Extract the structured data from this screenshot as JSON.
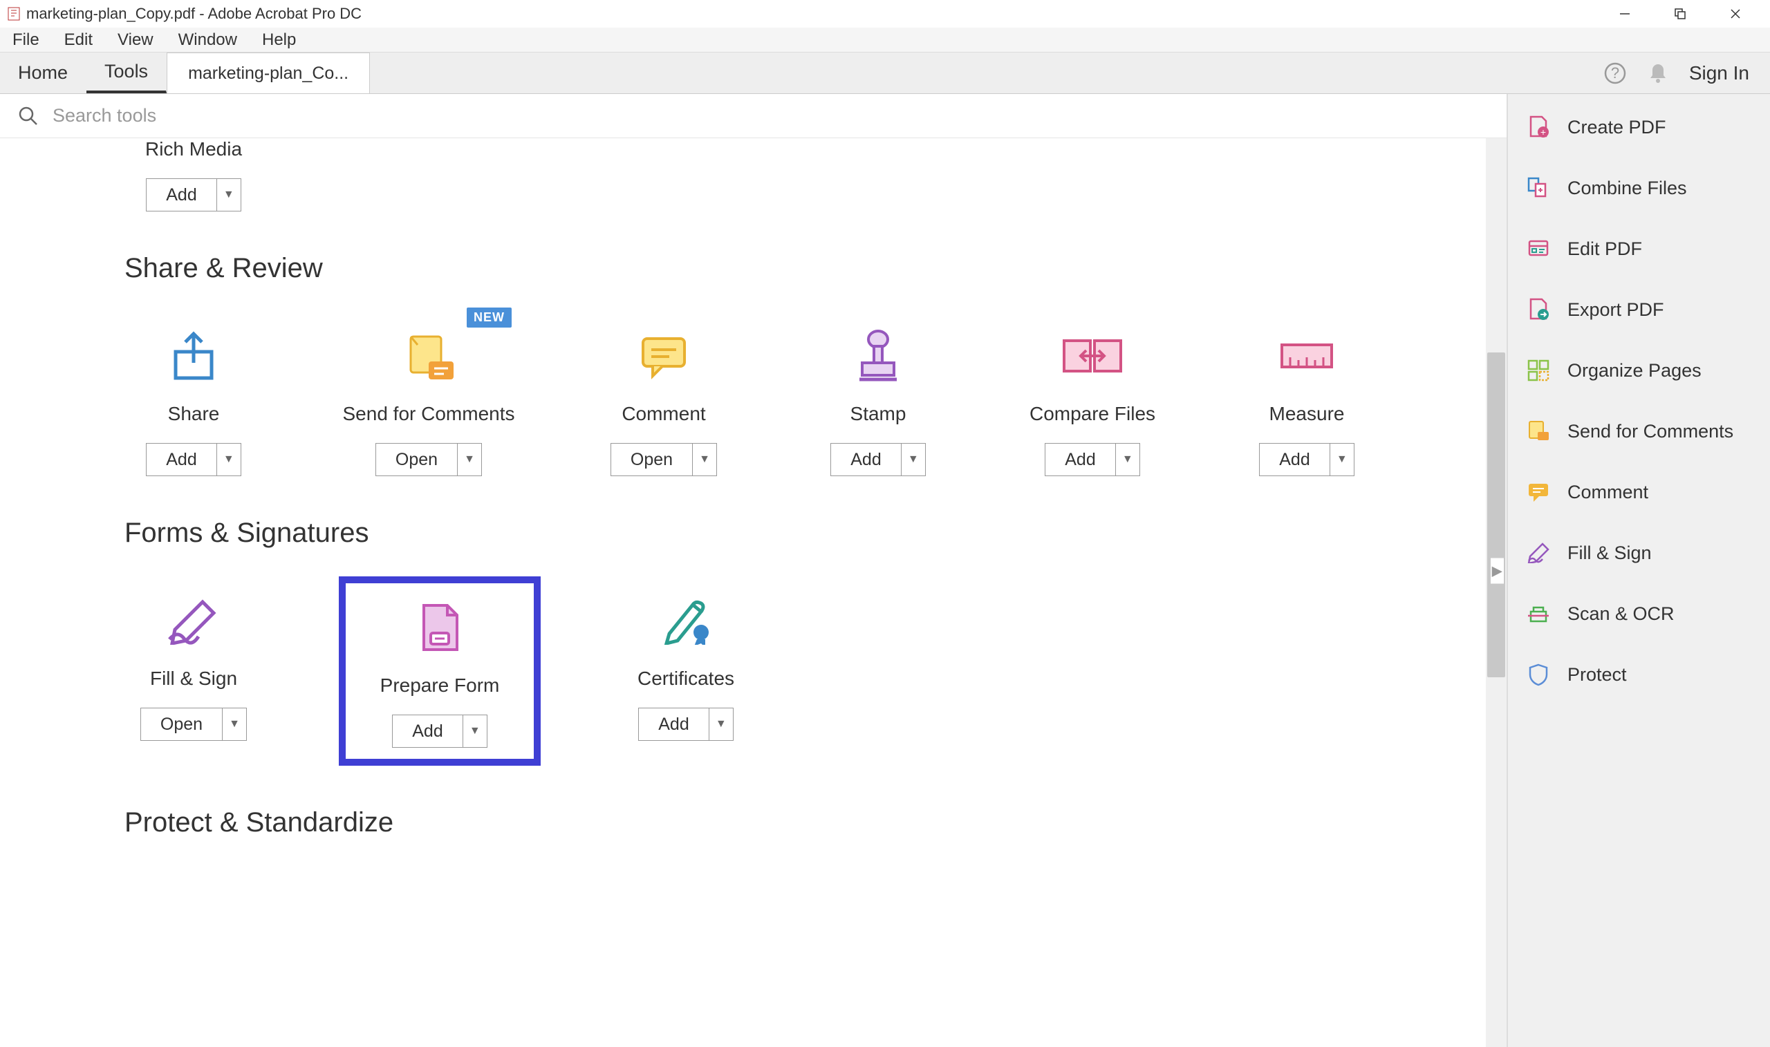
{
  "window": {
    "title": "marketing-plan_Copy.pdf - Adobe Acrobat Pro DC"
  },
  "menu": {
    "file": "File",
    "edit": "Edit",
    "view": "View",
    "window": "Window",
    "help": "Help"
  },
  "nav": {
    "home": "Home",
    "tools": "Tools",
    "doc_tab": "marketing-plan_Co...",
    "sign_in": "Sign In"
  },
  "search": {
    "placeholder": "Search tools"
  },
  "partial_tool": {
    "label": "Rich Media",
    "button": "Add"
  },
  "sections": {
    "share_review": {
      "title": "Share & Review",
      "tools": {
        "share": {
          "label": "Share",
          "button": "Add"
        },
        "send_comments": {
          "label": "Send for Comments",
          "button": "Open",
          "badge": "NEW"
        },
        "comment": {
          "label": "Comment",
          "button": "Open"
        },
        "stamp": {
          "label": "Stamp",
          "button": "Add"
        },
        "compare": {
          "label": "Compare Files",
          "button": "Add"
        },
        "measure": {
          "label": "Measure",
          "button": "Add"
        }
      }
    },
    "forms_sigs": {
      "title": "Forms & Signatures",
      "tools": {
        "fill_sign": {
          "label": "Fill & Sign",
          "button": "Open"
        },
        "prepare_form": {
          "label": "Prepare Form",
          "button": "Add"
        },
        "certificates": {
          "label": "Certificates",
          "button": "Add"
        }
      }
    },
    "protect": {
      "title": "Protect & Standardize"
    }
  },
  "sidebar": {
    "create_pdf": "Create PDF",
    "combine": "Combine Files",
    "edit_pdf": "Edit PDF",
    "export_pdf": "Export PDF",
    "organize": "Organize Pages",
    "send_comments": "Send for Comments",
    "comment": "Comment",
    "fill_sign": "Fill & Sign",
    "scan_ocr": "Scan & OCR",
    "protect": "Protect"
  }
}
